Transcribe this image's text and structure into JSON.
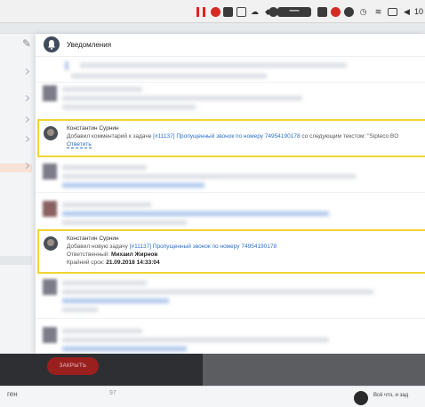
{
  "menubar": {
    "right_text": "10"
  },
  "panel": {
    "title": "Уведомления"
  },
  "notifications": [
    {
      "author": "Константин Сурнин",
      "action": "Добавил комментарий к задаче",
      "task_link": "[#11137] Пропущенный звонок по номеру 74954190178",
      "suffix": "со следующим текстом: \"Sipteco BO",
      "reply_label": "Ответить"
    },
    {
      "author": "Константин Сурнин",
      "action": "Добавил новую задачу",
      "task_link": "[#11137] Пропущенный звонок по номеру 74954190178",
      "responsible_label": "Ответственный:",
      "responsible_name": "Михаил Жирнов",
      "deadline_label": "Крайний срок:",
      "deadline_value": "21.09.2018 14:33:04"
    }
  ],
  "footer": {
    "close_label": "ЗАКРЫТЬ"
  },
  "bottom": {
    "left_text": "ген",
    "count_text": "97",
    "chat_text": "Всё что, и зад"
  }
}
